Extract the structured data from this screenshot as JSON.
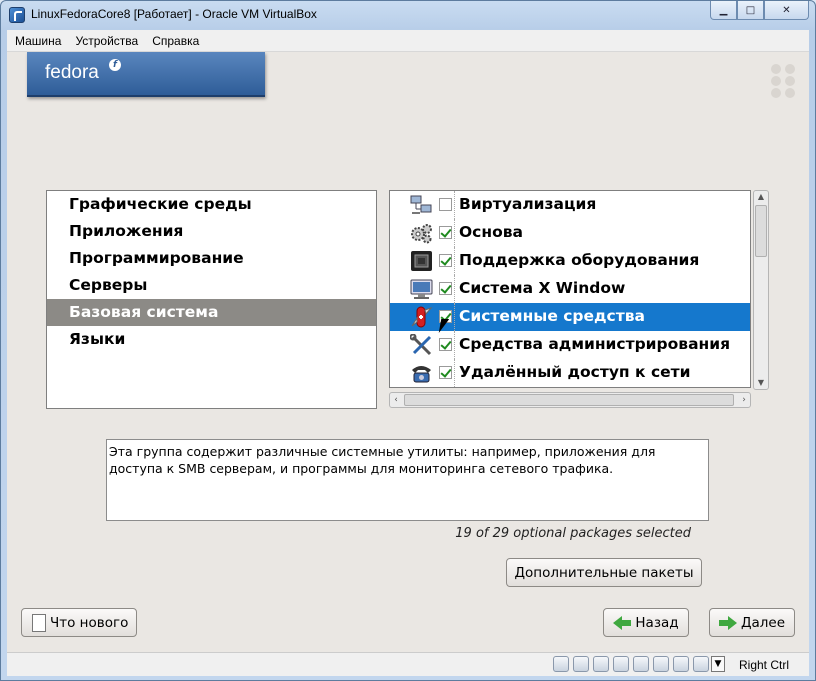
{
  "window": {
    "title": "LinuxFedoraCore8 [Работает] - Oracle VM VirtualBox"
  },
  "menubar": {
    "items": [
      "Машина",
      "Устройства",
      "Справка"
    ]
  },
  "banner": {
    "text": "fedora",
    "logo_glyph": "f"
  },
  "groups": {
    "items": [
      "Графические среды",
      "Приложения",
      "Программирование",
      "Серверы",
      "Базовая система",
      "Языки"
    ],
    "selected_index": 4
  },
  "packages": {
    "items": [
      {
        "label": "Виртуализация",
        "checked": false,
        "icon": "network-computers-icon"
      },
      {
        "label": "Основа",
        "checked": true,
        "icon": "gears-icon"
      },
      {
        "label": "Поддержка оборудования",
        "checked": true,
        "icon": "chip-icon"
      },
      {
        "label": "Система X Window",
        "checked": true,
        "icon": "monitor-icon"
      },
      {
        "label": "Системные средства",
        "checked": true,
        "icon": "swiss-knife-icon"
      },
      {
        "label": "Средства администрирования",
        "checked": true,
        "icon": "tools-icon"
      },
      {
        "label": "Удалённый доступ к сети",
        "checked": true,
        "icon": "phone-icon"
      }
    ],
    "selected_index": 4
  },
  "description": "Эта группа содержит различные системные утилиты: например, приложения для доступа к SMB серверам, и программы для мониторинга сетевого трафика.",
  "selection_count": "19 of 29 optional packages selected",
  "buttons": {
    "extra_packages": "Дополнительные пакеты",
    "whats_new": "Что нового",
    "back": "Назад",
    "next": "Далее"
  },
  "statusbar": {
    "host_key": "Right Ctrl"
  },
  "colors": {
    "selection": "#1578cd",
    "group_selection": "#8c8a86",
    "check": "#1f8a1f"
  }
}
